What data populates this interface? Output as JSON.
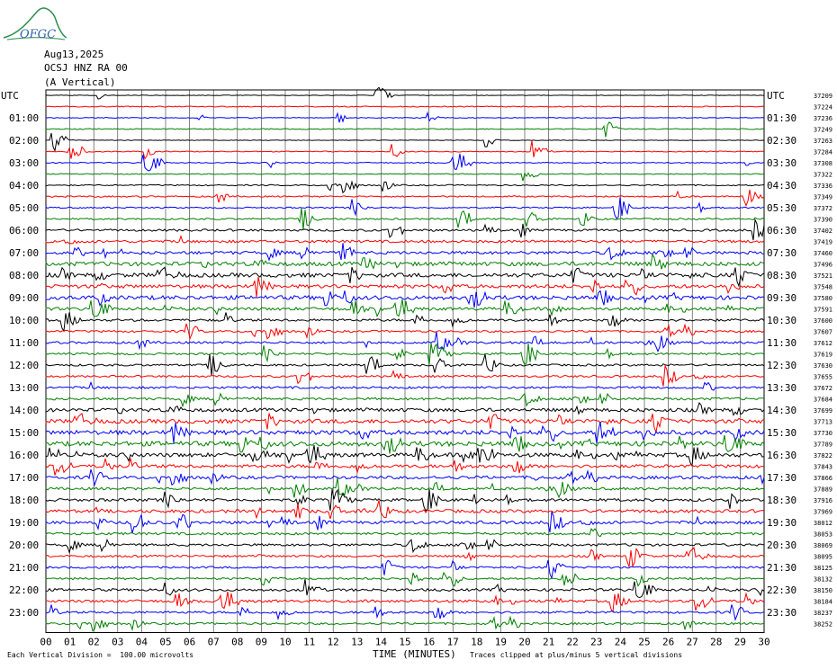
{
  "header": {
    "logo_text": "OFGC",
    "date": "Aug13,2025",
    "station": "OCSJ HNZ RA 00",
    "component": "(A Vertical)"
  },
  "axis_labels": {
    "left_utc": "UTC",
    "right_utc": "UTC",
    "xlabel": "TIME (MINUTES)"
  },
  "footer": {
    "scale_note": "Each Vertical Division =  100.00 microvolts",
    "clip_note": "Traces clipped at plus/minus 5 vertical divisions"
  },
  "colors": {
    "trace_cycle": [
      "#000000",
      "#ff0000",
      "#0000ff",
      "#008000"
    ],
    "gridline": "#000000"
  },
  "chart_data": {
    "type": "line",
    "title": "Aug13,2025",
    "xlabel": "TIME (MINUTES)",
    "ylabel": "UTC",
    "xlim": [
      0,
      30
    ],
    "x_ticks": [
      "00",
      "01",
      "02",
      "03",
      "04",
      "05",
      "06",
      "07",
      "08",
      "09",
      "10",
      "11",
      "12",
      "13",
      "14",
      "15",
      "16",
      "17",
      "18",
      "19",
      "20",
      "21",
      "22",
      "23",
      "24",
      "25",
      "26",
      "27",
      "28",
      "29",
      "30"
    ],
    "rows": 48,
    "left_ticks": [
      "UTC",
      "01:00",
      "02:00",
      "03:00",
      "04:00",
      "05:00",
      "06:00",
      "07:00",
      "08:00",
      "09:00",
      "10:00",
      "11:00",
      "12:00",
      "13:00",
      "14:00",
      "15:00",
      "16:00",
      "17:00",
      "18:00",
      "19:00",
      "20:00",
      "21:00",
      "22:00",
      "23:00"
    ],
    "right_ticks": [
      "UTC",
      "01:30",
      "02:30",
      "03:30",
      "04:30",
      "05:30",
      "06:30",
      "07:30",
      "08:30",
      "09:30",
      "10:30",
      "11:30",
      "12:30",
      "13:30",
      "14:30",
      "15:30",
      "16:30",
      "17:30",
      "18:30",
      "19:30",
      "20:30",
      "21:30",
      "22:30",
      "23:30"
    ],
    "trace_ids": [
      "37209",
      "37224",
      "37236",
      "37249",
      "37263",
      "37284",
      "37308",
      "37322",
      "37336",
      "37349",
      "37372",
      "37390",
      "37402",
      "37419",
      "37460",
      "37496",
      "37521",
      "37548",
      "37580",
      "37591",
      "37600",
      "37607",
      "37612",
      "37619",
      "37630",
      "37655",
      "37672",
      "37684",
      "37699",
      "37713",
      "37730",
      "37789",
      "37822",
      "37843",
      "37866",
      "37889",
      "37916",
      "37969",
      "38012",
      "38053",
      "38069",
      "38095",
      "38125",
      "38132",
      "38150",
      "38184",
      "38237",
      "38252"
    ],
    "activity": [
      0.3,
      0.5,
      0.4,
      0.5,
      0.3,
      0.5,
      0.5,
      0.5,
      0.6,
      0.7,
      0.7,
      0.8,
      1.1,
      1.3,
      1.5,
      2.0,
      2.0,
      1.8,
      2.0,
      1.5,
      1.2,
      1.0,
      1.1,
      1.0,
      1.0,
      1.0,
      1.1,
      1.2,
      1.8,
      2.0,
      2.2,
      2.4,
      2.0,
      1.6,
      1.5,
      1.3,
      1.4,
      1.6,
      1.5,
      1.2,
      1.2,
      1.0,
      1.0,
      1.0,
      1.3,
      1.3,
      1.1,
      1.0
    ],
    "grid": true
  }
}
